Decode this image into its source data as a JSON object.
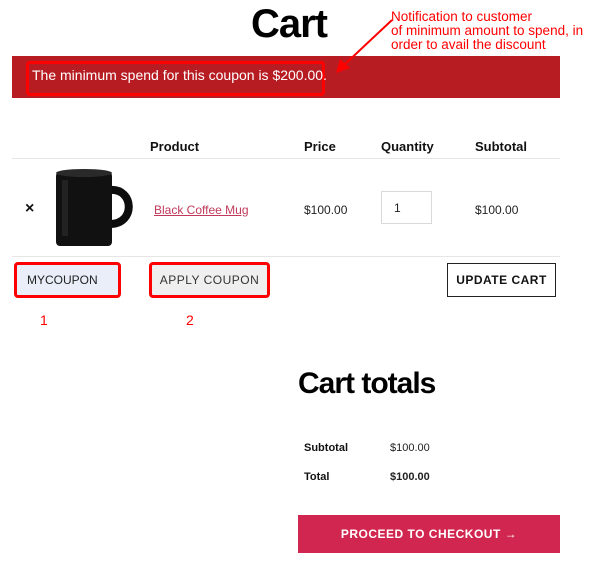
{
  "page": {
    "title": "Cart"
  },
  "notice": {
    "message": "The minimum spend for this coupon is $200.00."
  },
  "annotations": {
    "callout_lines": [
      "Notification to customer",
      "of minimum amount to spend, in",
      "order to avail the discount"
    ],
    "label_1": "1",
    "label_2": "2",
    "highlight_color": "#ff0000"
  },
  "cart_table": {
    "headers": {
      "product": "Product",
      "price": "Price",
      "quantity": "Quantity",
      "subtotal": "Subtotal"
    },
    "rows": [
      {
        "remove": "×",
        "product_name": "Black Coffee Mug",
        "price": "$100.00",
        "quantity": "1",
        "subtotal": "$100.00",
        "image": "black-mug"
      }
    ]
  },
  "coupon": {
    "code_value": "MYCOUPON",
    "apply_label": "APPLY COUPON"
  },
  "update_cart_label": "UPDATE CART",
  "totals": {
    "title": "Cart totals",
    "subtotal_label": "Subtotal",
    "subtotal_value": "$100.00",
    "total_label": "Total",
    "total_value": "$100.00"
  },
  "checkout": {
    "label": "PROCEED TO CHECKOUT →"
  },
  "colors": {
    "notice_bg": "#b81c23",
    "accent": "#d1264f",
    "link": "#c0395a"
  }
}
